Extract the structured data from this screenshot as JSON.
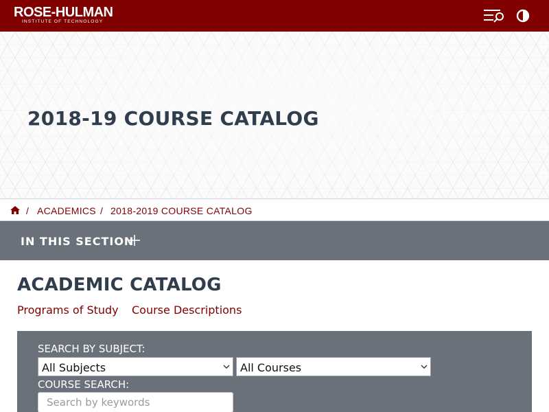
{
  "brand": {
    "logo_main": "ROSE-HULMAN",
    "logo_sub": "INSTITUTE OF TECHNOLOGY",
    "color": "#800000"
  },
  "header_icons": [
    "menu-search-icon",
    "contrast-icon"
  ],
  "hero": {
    "title": "2018-19 COURSE CATALOG"
  },
  "breadcrumb": {
    "home_icon": "home-icon",
    "separator": "/",
    "items": [
      "ACADEMICS",
      "2018-2019 COURSE CATALOG"
    ]
  },
  "section_nav": {
    "label": "IN THIS SECTION",
    "icon": "plus-icon"
  },
  "main": {
    "heading": "ACADEMIC CATALOG",
    "links": [
      "Programs of Study",
      "Course Descriptions"
    ]
  },
  "search": {
    "subject_label": "SEARCH BY SUBJECT:",
    "subject_select": "All Subjects",
    "course_select": "All Courses",
    "course_search_label": "COURSE SEARCH:",
    "keyword_placeholder": "Search by keywords"
  },
  "colors": {
    "accent": "#800000",
    "heading": "#2f3d4d",
    "panel": "#6b717a"
  }
}
